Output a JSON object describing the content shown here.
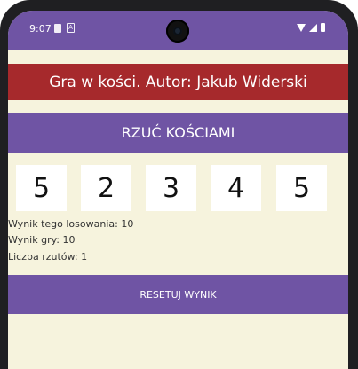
{
  "status_bar": {
    "time": "9:07"
  },
  "app": {
    "title": "Gra w kości. Autor: Jakub Widerski",
    "roll_button_label": "RZUĆ KOŚCIAMI",
    "dice": [
      "5",
      "2",
      "3",
      "4",
      "5"
    ],
    "roll_result_text": "Wynik tego losowania: 10",
    "game_score_text": "Wynik gry: 10",
    "roll_count_text": "Liczba rzutów: 1",
    "reset_button_label": "RESETUJ WYNIK"
  },
  "colors": {
    "primary": "#6f54a4",
    "title_bar": "#a6292c",
    "background": "#f6f3dd"
  }
}
